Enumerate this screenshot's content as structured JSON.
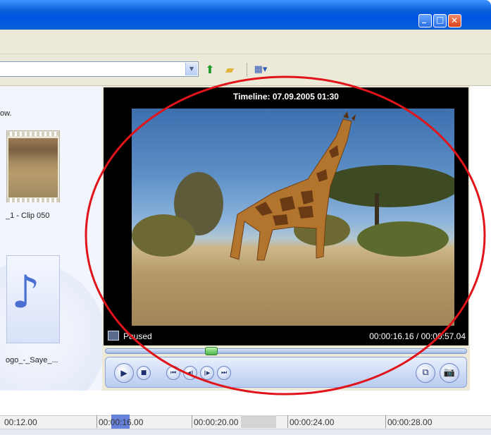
{
  "window": {
    "minimize_glyph": "_",
    "maximize_glyph": "□",
    "close_glyph": "✕"
  },
  "left_pane": {
    "text_top": "ow.",
    "clip_caption": "_1 - Clip 050",
    "audio_caption": "ogo_-_Saye_..."
  },
  "player": {
    "title": "Timeline: 07.09.2005 01:30",
    "status": "Paused",
    "time": "00:00:16.16 / 00:00:57.04"
  },
  "controls": {
    "play": "▶",
    "stop": "■",
    "prev": "⏮",
    "back": "◀‖",
    "forward": "‖▶",
    "next": "⏭",
    "split": "⧉",
    "snapshot": "📷"
  },
  "timeline": {
    "ticks": [
      "00:12.00",
      "00:00:16.00",
      "00:00:20.00",
      "00:00:24.00",
      "00:00:28.00"
    ],
    "current_highlight": "16"
  },
  "colors": {
    "titlebar": "#0054e3",
    "annotation": "#e0141a",
    "seek_thumb": "#4cb24a"
  }
}
